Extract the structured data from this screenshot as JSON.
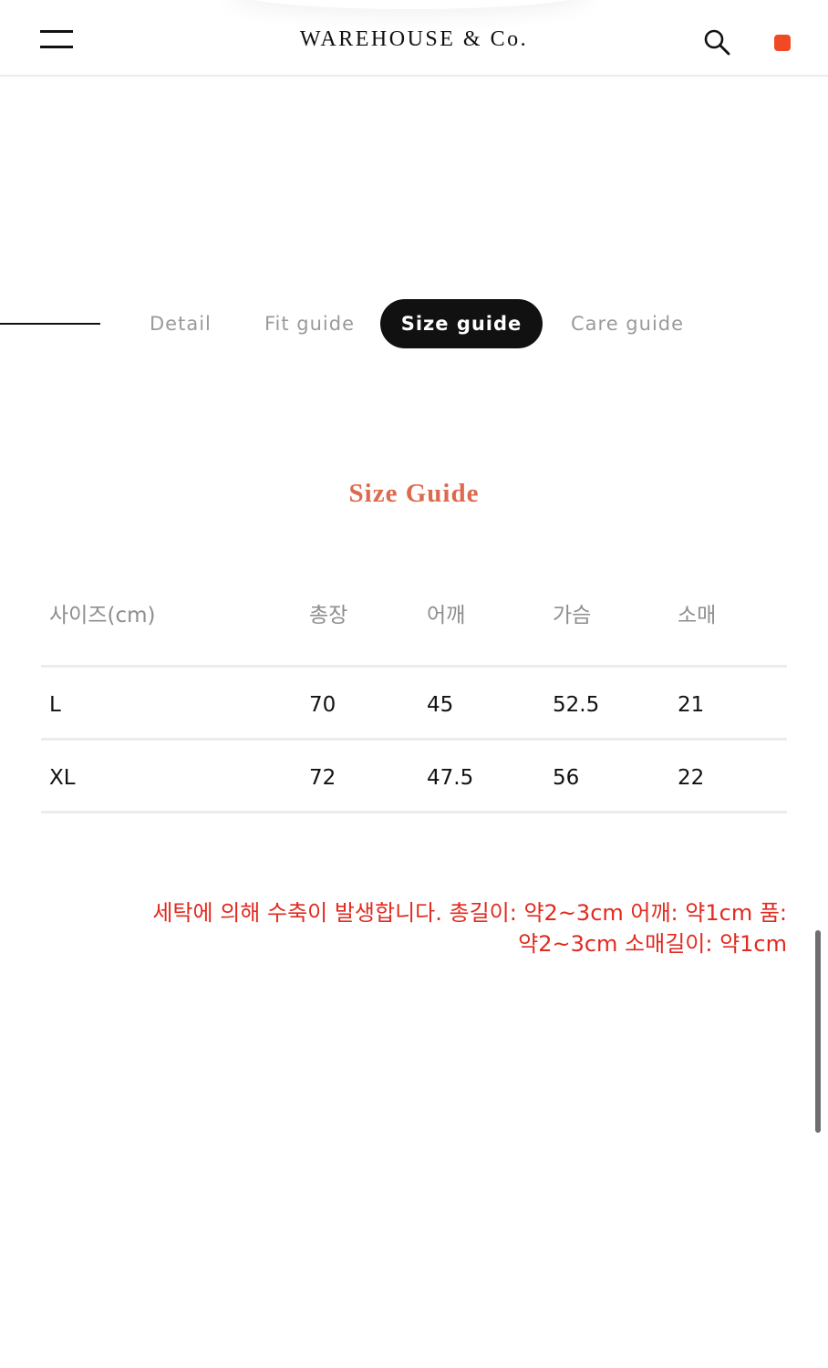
{
  "header": {
    "brand": "WAREHOUSE & Co.",
    "menu_icon": "hamburger-icon",
    "search_icon": "search-icon",
    "cart_icon": "cart-badge-icon",
    "cart_color": "#f04a24"
  },
  "tabs": [
    {
      "label": "Detail",
      "active": false
    },
    {
      "label": "Fit guide",
      "active": false
    },
    {
      "label": "Size guide",
      "active": true
    },
    {
      "label": "Care guide",
      "active": false
    }
  ],
  "section": {
    "title": "Size Guide",
    "title_color": "#dc6a4e"
  },
  "table": {
    "headers": [
      "사이즈(cm)",
      "총장",
      "어깨",
      "가슴",
      "소매"
    ],
    "rows": [
      [
        "L",
        "70",
        "45",
        "52.5",
        "21"
      ],
      [
        "XL",
        "72",
        "47.5",
        "56",
        "22"
      ]
    ]
  },
  "note": {
    "line1": "세탁에 의해 수축이 발생합니다. 총길이: 약2~3cm 어깨: 약1cm 품:",
    "line2": "약2~3cm 소매길이: 약1cm",
    "color": "#e02b20"
  }
}
